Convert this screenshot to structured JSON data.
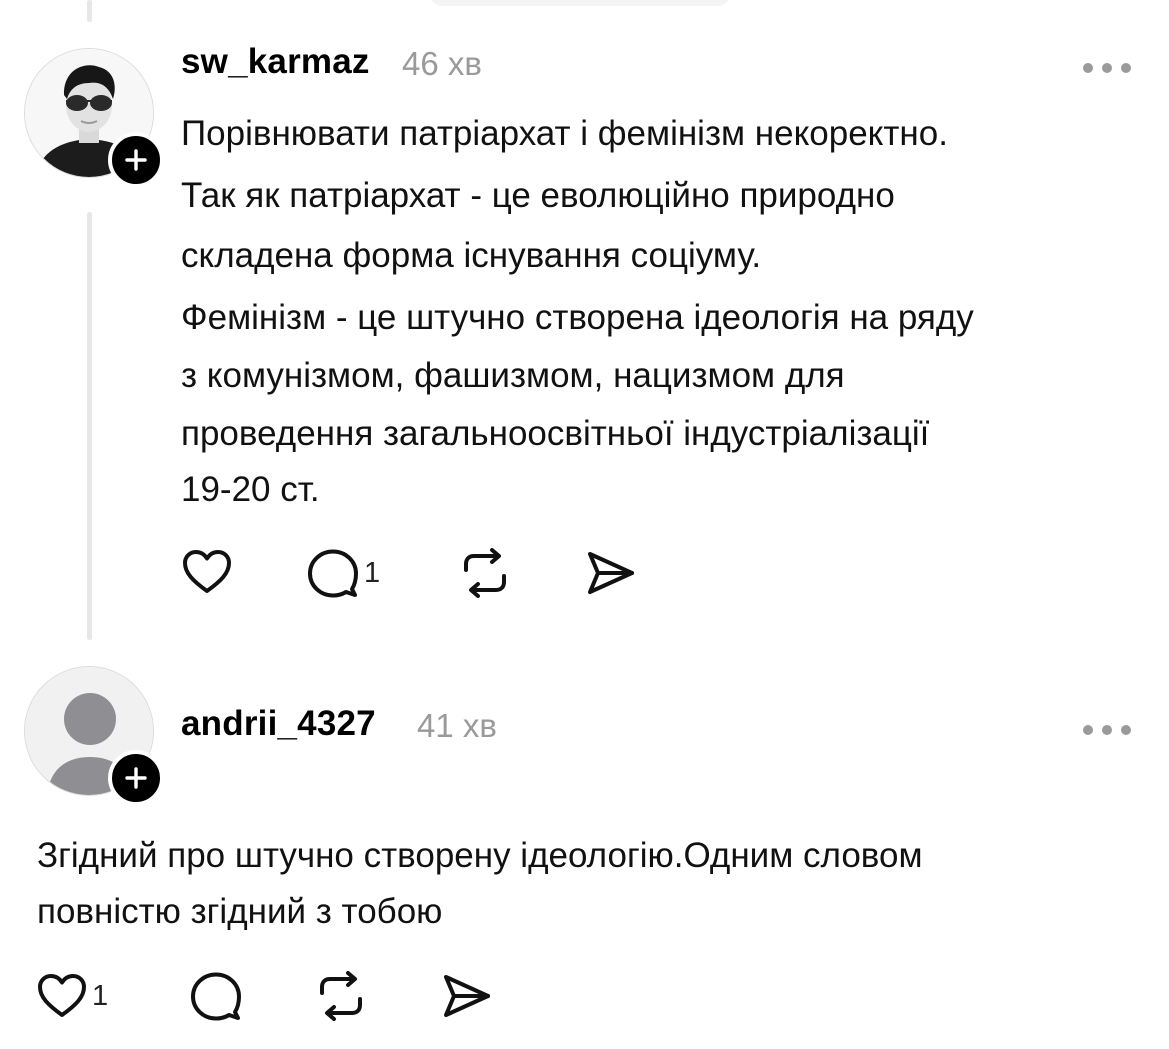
{
  "comments": [
    {
      "username": "sw_karmaz",
      "time": "46 хв",
      "paragraphs": [
        "Порівнювати патріархат і фемінізм некоректно.",
        "Так як патріархат - це еволюційно природно",
        "складена форма існування соціуму.",
        "Фемінізм - це штучно створена ідеологія на ряду",
        "з комунізмом, фашизмом, нацизмом для",
        "проведення загальноосвітньої індустріалізації",
        "19-20 ст."
      ],
      "reply_count": "1",
      "like_count": ""
    },
    {
      "username": "andrii_4327",
      "time": "41 хв",
      "paragraphs": [
        "Згідний про штучно створену ідеологію.Одним словом",
        "повністю згідний з тобою"
      ],
      "like_count": "1",
      "reply_count": ""
    }
  ],
  "icons": {
    "like": "heart-icon",
    "reply": "speech-bubble-icon",
    "repost": "repost-icon",
    "share": "send-icon",
    "more": "ellipsis-icon",
    "follow": "plus-icon"
  },
  "colors": {
    "text": "#000000",
    "secondary": "#9a9a9a",
    "thread_line": "#e7e7e7"
  }
}
